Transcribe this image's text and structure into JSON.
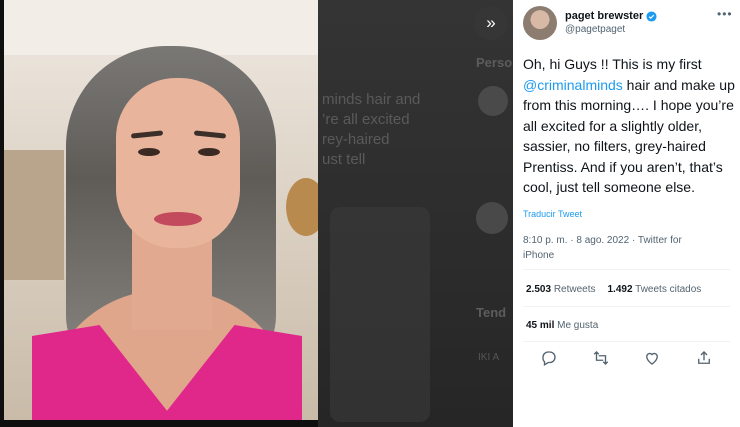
{
  "author": {
    "name": "paget brewster",
    "handle": "@pagetpaget"
  },
  "tweet": {
    "text_before": "Oh, hi Guys !! This is my first ",
    "mention": "@criminalminds",
    "text_after": " hair and make up from this morning…. I hope you’re all excited for a slightly older, sassier, no filters, grey-haired Prentiss. And if you aren’t, that’s cool, just tell someone else.",
    "translate_label": "Traducir Tweet",
    "timestamp": "8:10 p. m. · 8 ago. 2022 · Twitter for iPhone"
  },
  "stats": {
    "retweets_count": "2.503",
    "retweets_label": "Retweets",
    "quotes_count": "1.492",
    "quotes_label": "Tweets citados",
    "likes_count": "45 mil",
    "likes_label": "Me gusta"
  },
  "icons": {
    "expand": "double-chevron-right-icon",
    "more": "more-horizontal-icon",
    "verified": "verified-badge-icon",
    "reply": "reply-icon",
    "retweet": "retweet-icon",
    "like": "heart-icon",
    "share": "share-icon"
  },
  "background": {
    "line1": "minds hair and",
    "line2": "’re all excited",
    "line3": "rey-haired",
    "line4": "ust tell",
    "label_pers": "Perso",
    "label_tend": "Tend",
    "trend_name": "IKI A"
  },
  "colors": {
    "link": "#1d9bf0",
    "text": "#0f1419",
    "secondary": "#536471",
    "overlay": "#0f0f0f"
  }
}
